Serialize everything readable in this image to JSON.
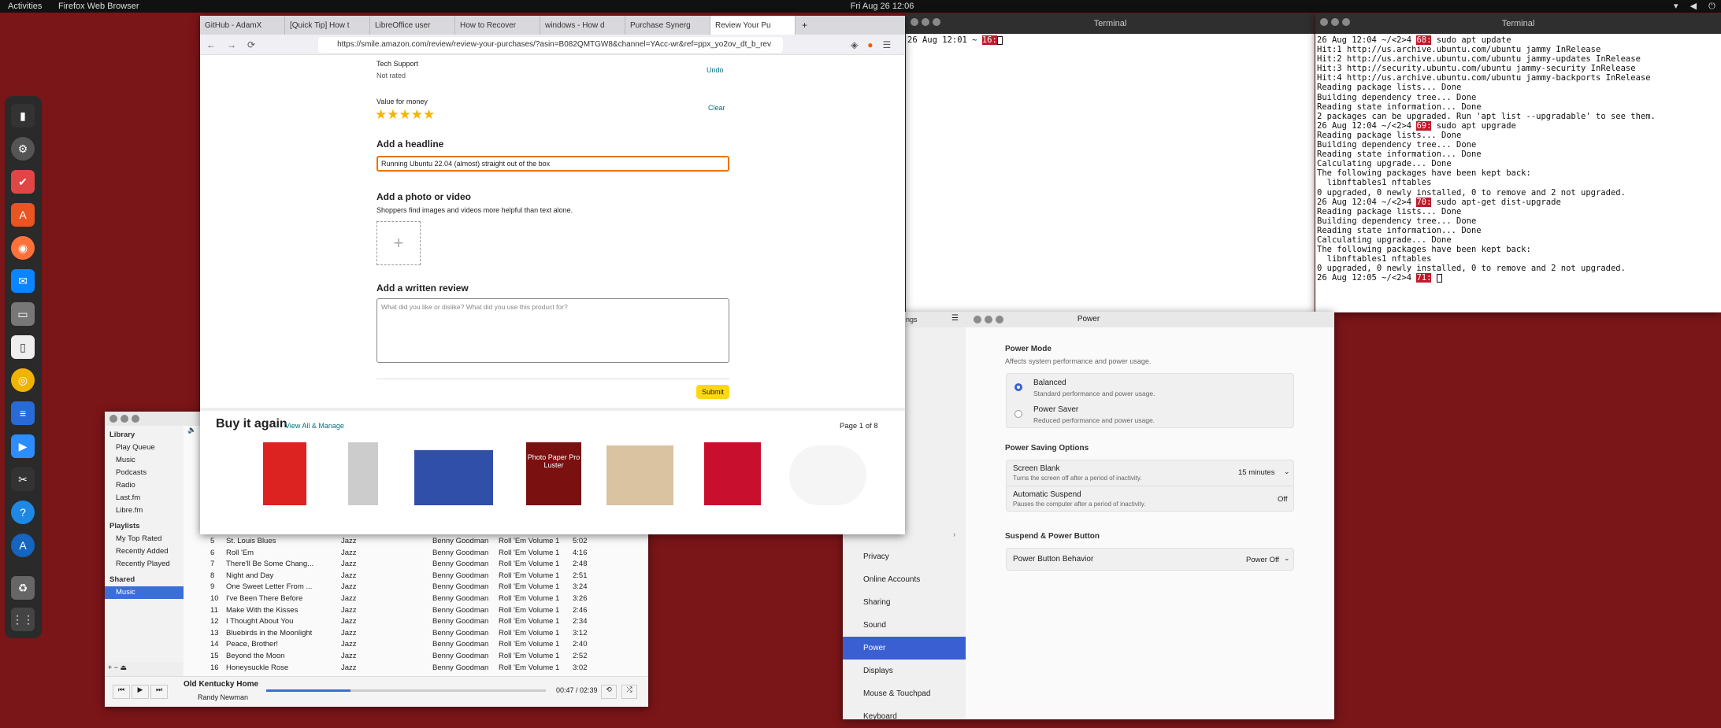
{
  "topbar": {
    "activities": "Activities",
    "app": "Firefox Web Browser",
    "clock": "Fri Aug 26  12:06",
    "tray": "▾ ◀ ⏻ ▾"
  },
  "firefox": {
    "tabs": [
      "GitHub - AdamX",
      "[Quick Tip] How t",
      "LibreOffice user",
      "How to Recover",
      "windows - How d",
      "Purchase Synerg",
      "Review Your Pu"
    ],
    "url": "https://smile.amazon.com/review/review-your-purchases/?asin=B082QMTGW8&channel=YAcc-wr&ref=ppx_yo2ov_dt_b_rev",
    "tech_support_label": "Tech Support",
    "tech_support_value": "Not rated",
    "undo": "Undo",
    "value_label": "Value for money",
    "clear": "Clear",
    "stars": "★★★★★",
    "headline_title": "Add a headline",
    "headline_value": "Running Ubuntu 22.04 (almost) straight out of the box",
    "photo_title": "Add a photo or video",
    "photo_sub": "Shoppers find images and videos more helpful than text alone.",
    "review_title": "Add a written review",
    "review_placeholder": "What did you like or dislike? What did you use this product for?",
    "submit": "Submit",
    "buy_again": "Buy it again",
    "view_all": "View All & Manage",
    "page": "Page 1 of 8",
    "product_text": "Photo Paper Pro Luster"
  },
  "term1": {
    "title": "Terminal",
    "line_pre": "26 Aug 12:01 ~ ",
    "prompt": "16:"
  },
  "term2": {
    "title": "Terminal",
    "lines": [
      {
        "pre": "26 Aug 12:04 ~/<2>4 ",
        "prompt": "68:",
        "post": " sudo apt update"
      },
      {
        "pre": "Hit:1 http://us.archive.ubuntu.com/ubuntu jammy InRelease"
      },
      {
        "pre": "Hit:2 http://us.archive.ubuntu.com/ubuntu jammy-updates InRelease"
      },
      {
        "pre": "Hit:3 http://security.ubuntu.com/ubuntu jammy-security InRelease"
      },
      {
        "pre": "Hit:4 http://us.archive.ubuntu.com/ubuntu jammy-backports InRelease"
      },
      {
        "pre": "Reading package lists... Done"
      },
      {
        "pre": "Building dependency tree... Done"
      },
      {
        "pre": "Reading state information... Done"
      },
      {
        "pre": "2 packages can be upgraded. Run 'apt list --upgradable' to see them."
      },
      {
        "pre": "26 Aug 12:04 ~/<2>4 ",
        "prompt": "69:",
        "post": " sudo apt upgrade"
      },
      {
        "pre": "Reading package lists... Done"
      },
      {
        "pre": "Building dependency tree... Done"
      },
      {
        "pre": "Reading state information... Done"
      },
      {
        "pre": "Calculating upgrade... Done"
      },
      {
        "pre": "The following packages have been kept back:"
      },
      {
        "pre": "  libnftables1 nftables"
      },
      {
        "pre": "0 upgraded, 0 newly installed, 0 to remove and 2 not upgraded."
      },
      {
        "pre": "26 Aug 12:04 ~/<2>4 ",
        "prompt": "70:",
        "post": " sudo apt-get dist-upgrade"
      },
      {
        "pre": "Reading package lists... Done"
      },
      {
        "pre": "Building dependency tree... Done"
      },
      {
        "pre": "Reading state information... Done"
      },
      {
        "pre": "Calculating upgrade... Done"
      },
      {
        "pre": "The following packages have been kept back:"
      },
      {
        "pre": "  libnftables1 nftables"
      },
      {
        "pre": "0 upgraded, 0 newly installed, 0 to remove and 2 not upgraded."
      },
      {
        "pre": "26 Aug 12:05 ~/<2>4 ",
        "prompt": "71:",
        "post": " "
      }
    ]
  },
  "rhythmbox": {
    "library": "Library",
    "sources": [
      "Play Queue",
      "Music",
      "Podcasts",
      "Radio",
      "Last.fm",
      "Libre.fm"
    ],
    "playlists": "Playlists",
    "playlist_items": [
      "My Top Rated",
      "Recently Added",
      "Recently Played"
    ],
    "shared": "Shared",
    "shared_items": [
      "Music"
    ],
    "tracks": [
      [
        "5",
        "St. Louis Blues",
        "Jazz",
        "Benny Goodman",
        "Roll 'Em Volume 1",
        "5:02"
      ],
      [
        "6",
        "Roll 'Em",
        "Jazz",
        "Benny Goodman",
        "Roll 'Em Volume 1",
        "4:16"
      ],
      [
        "7",
        "There'll Be Some Chang...",
        "Jazz",
        "Benny Goodman",
        "Roll 'Em Volume 1",
        "2:48"
      ],
      [
        "8",
        "Night and Day",
        "Jazz",
        "Benny Goodman",
        "Roll 'Em Volume 1",
        "2:51"
      ],
      [
        "9",
        "One Sweet Letter From ...",
        "Jazz",
        "Benny Goodman",
        "Roll 'Em Volume 1",
        "3:24"
      ],
      [
        "10",
        "I've Been There Before",
        "Jazz",
        "Benny Goodman",
        "Roll 'Em Volume 1",
        "3:26"
      ],
      [
        "11",
        "Make With the Kisses",
        "Jazz",
        "Benny Goodman",
        "Roll 'Em Volume 1",
        "2:46"
      ],
      [
        "12",
        "I Thought About You",
        "Jazz",
        "Benny Goodman",
        "Roll 'Em Volume 1",
        "2:34"
      ],
      [
        "13",
        "Bluebirds in the Moonlight",
        "Jazz",
        "Benny Goodman",
        "Roll 'Em Volume 1",
        "3:12"
      ],
      [
        "14",
        "Peace, Brother!",
        "Jazz",
        "Benny Goodman",
        "Roll 'Em Volume 1",
        "2:40"
      ],
      [
        "15",
        "Beyond the Moon",
        "Jazz",
        "Benny Goodman",
        "Roll 'Em Volume 1",
        "2:52"
      ],
      [
        "16",
        "Honeysuckle Rose",
        "Jazz",
        "Benny Goodman",
        "Roll 'Em Volume 1",
        "3:02"
      ]
    ],
    "now_title": "Old Kentucky Home",
    "now_artist": "Randy Newman",
    "time": "00:47 / 02:39",
    "progress": 0.3
  },
  "settings": {
    "title": "Power",
    "side_fragment": "ngs",
    "side_items": [
      "Privacy",
      "Online Accounts",
      "Sharing",
      "Sound",
      "Power",
      "Displays",
      "Mouse & Touchpad",
      "Keyboard"
    ],
    "power_mode": "Power Mode",
    "power_mode_sub": "Affects system performance and power usage.",
    "balanced": "Balanced",
    "balanced_sub": "Standard performance and power usage.",
    "saver": "Power Saver",
    "saver_sub": "Reduced performance and power usage.",
    "saving_title": "Power Saving Options",
    "blank": "Screen Blank",
    "blank_sub": "Turns the screen off after a period of inactivity.",
    "blank_val": "15 minutes",
    "suspend": "Automatic Suspend",
    "suspend_sub": "Pauses the computer after a period of inactivity.",
    "suspend_val": "Off",
    "button_title": "Suspend & Power Button",
    "button_label": "Power Button Behavior",
    "button_val": "Power Off"
  }
}
